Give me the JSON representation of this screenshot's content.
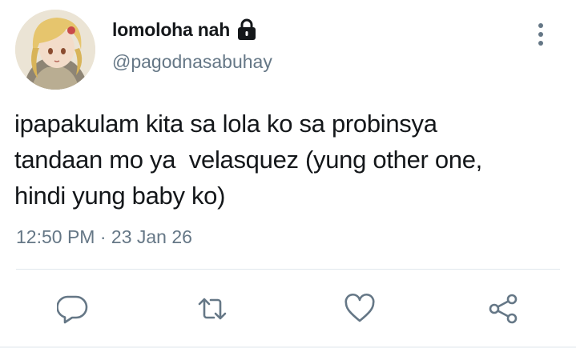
{
  "user": {
    "display_name": "lomoloha nah",
    "handle": "@pagodnasabuhay",
    "protected_icon": "lock-icon",
    "avatar_icon": "avatar"
  },
  "tweet": {
    "text": "ipapakulam kita sa lola ko sa probinsya\ntandaan mo ya  velasquez (yung other one,\nhindi yung baby ko)",
    "time": "12:50 PM",
    "separator": "·",
    "date": "23 Jan 26"
  },
  "menu": {
    "icon": "more-vertical-icon"
  },
  "actions": [
    {
      "name": "reply",
      "icon": "reply-icon"
    },
    {
      "name": "retweet",
      "icon": "retweet-icon"
    },
    {
      "name": "like",
      "icon": "heart-icon"
    },
    {
      "name": "share",
      "icon": "share-icon"
    }
  ],
  "colors": {
    "text_primary": "#14171a",
    "text_secondary": "#657786",
    "icon": "#657786",
    "divider": "#e1e8ed"
  }
}
